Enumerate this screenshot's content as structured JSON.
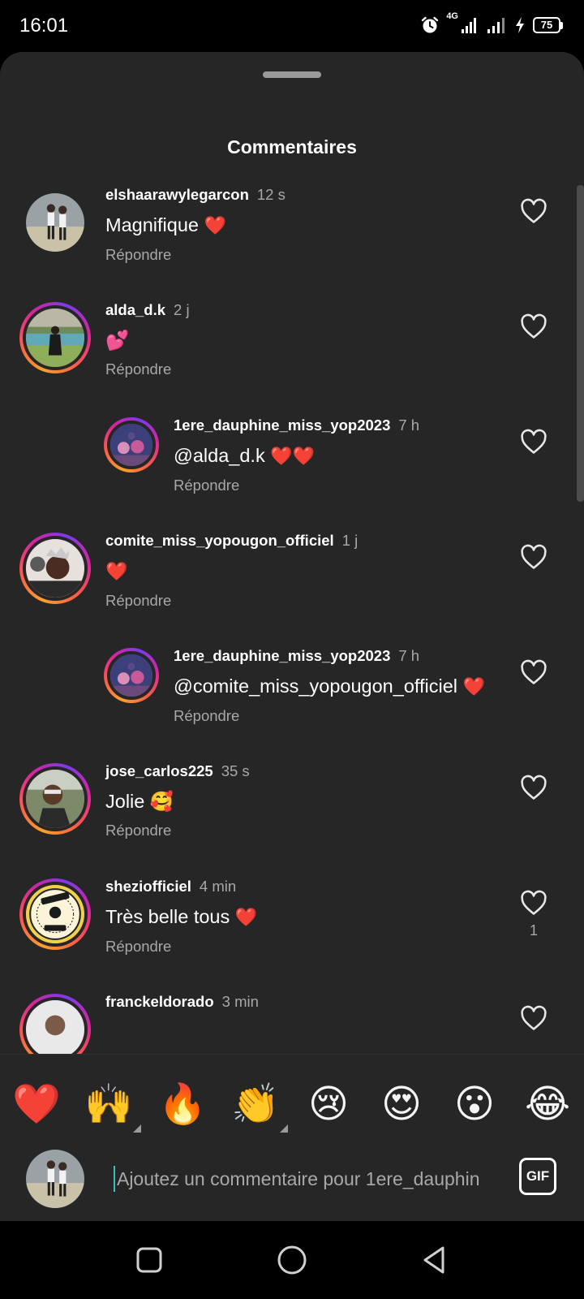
{
  "status_bar": {
    "time": "16:01",
    "network": "4G",
    "battery": "75"
  },
  "sheet": {
    "title": "Commentaires"
  },
  "comments": [
    {
      "username": "elshaarawylegarcon",
      "time": "12 s",
      "text": "Magnifique",
      "emoji": "❤️",
      "reply_label": "Répondre",
      "like_count": "",
      "is_reply": false,
      "ring": false
    },
    {
      "username": "alda_d.k",
      "time": "2 j",
      "text": "",
      "emoji": "💕",
      "reply_label": "Répondre",
      "like_count": "",
      "is_reply": false,
      "ring": true
    },
    {
      "username": "1ere_dauphine_miss_yop2023",
      "time": "7 h",
      "text": "@alda_d.k",
      "emoji": "❤️❤️",
      "reply_label": "Répondre",
      "like_count": "",
      "is_reply": true,
      "ring": true
    },
    {
      "username": "comite_miss_yopougon_officiel",
      "time": "1 j",
      "text": "",
      "emoji": "❤️",
      "reply_label": "Répondre",
      "like_count": "",
      "is_reply": false,
      "ring": true
    },
    {
      "username": "1ere_dauphine_miss_yop2023",
      "time": "7 h",
      "text": "@comite_miss_yopougon_officiel",
      "emoji": "❤️",
      "reply_label": "Répondre",
      "like_count": "",
      "is_reply": true,
      "ring": true
    },
    {
      "username": "jose_carlos225",
      "time": "35 s",
      "text": "Jolie",
      "emoji": "🥰",
      "reply_label": "Répondre",
      "like_count": "",
      "is_reply": false,
      "ring": true
    },
    {
      "username": "sheziofficiel",
      "time": "4 min",
      "text": "Très belle tous",
      "emoji": "❤️",
      "reply_label": "Répondre",
      "like_count": "1",
      "is_reply": false,
      "ring": true
    },
    {
      "username": "franckeldorado",
      "time": "3 min",
      "text": "",
      "emoji": "",
      "reply_label": "",
      "like_count": "",
      "is_reply": false,
      "ring": true
    }
  ],
  "emoji_bar": [
    "❤️",
    "🙌",
    "🔥",
    "👏",
    "😢",
    "😍",
    "😮",
    "😂"
  ],
  "composer": {
    "placeholder": "Ajoutez un commentaire pour 1ere_dauphin",
    "gif_label": "GIF"
  }
}
